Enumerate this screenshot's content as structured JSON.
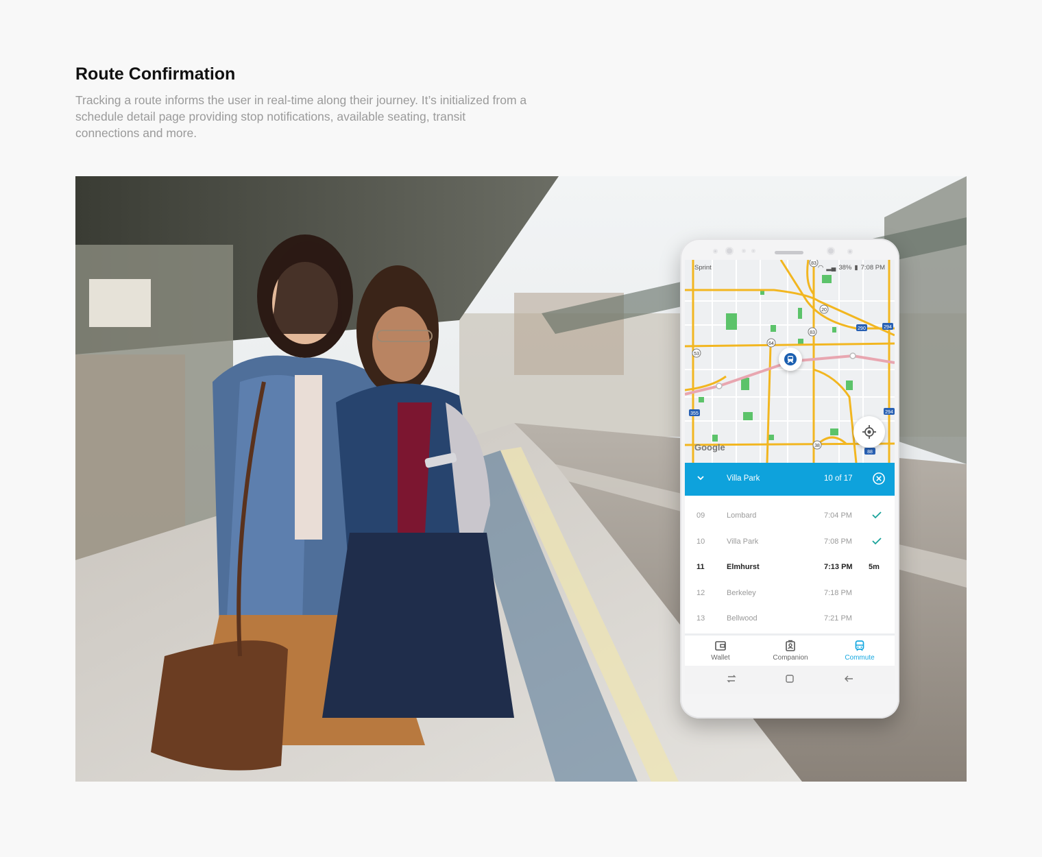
{
  "section": {
    "title": "Route Confirmation",
    "description": "Tracking a route informs the user in real-time along their journey. It’s initialized from a schedule detail page providing stop notifications, available seating, transit connections and more."
  },
  "phone": {
    "status_bar": {
      "carrier": "Sprint",
      "battery": "38%",
      "time": "7:08 PM"
    },
    "map": {
      "attribution": "Google",
      "route_color": "#e8a6b0",
      "highway_labels": [
        "83",
        "20",
        "290",
        "294",
        "64",
        "53",
        "83",
        "355",
        "294",
        "38",
        "88"
      ]
    },
    "route_bar": {
      "stop_name": "Villa Park",
      "progress": "10 of 17",
      "color": "#0ea2dc"
    },
    "stops": [
      {
        "number": "09",
        "name": "Lombard",
        "time": "7:04 PM",
        "status": "passed"
      },
      {
        "number": "10",
        "name": "Villa Park",
        "time": "7:08 PM",
        "status": "passed"
      },
      {
        "number": "11",
        "name": "Elmhurst",
        "time": "7:13 PM",
        "eta": "5m",
        "status": "current"
      },
      {
        "number": "12",
        "name": "Berkeley",
        "time": "7:18 PM",
        "status": "upcoming"
      },
      {
        "number": "13",
        "name": "Bellwood",
        "time": "7:21 PM",
        "status": "upcoming"
      }
    ],
    "bottom_nav": [
      {
        "label": "Wallet",
        "icon": "wallet-icon",
        "active": false
      },
      {
        "label": "Companion",
        "icon": "companion-icon",
        "active": false
      },
      {
        "label": "Commute",
        "icon": "train-icon",
        "active": true
      }
    ],
    "accent_color": "#13a7e0",
    "check_color": "#1aa39a"
  }
}
